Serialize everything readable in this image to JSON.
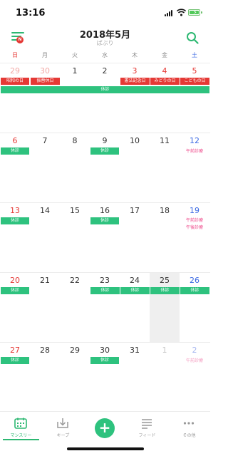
{
  "status": {
    "time": "13:16"
  },
  "header": {
    "title": "2018年5月",
    "subtitle": "ぱぶり",
    "menu_badge": "N"
  },
  "weekdays": [
    "日",
    "月",
    "火",
    "水",
    "木",
    "金",
    "土"
  ],
  "weeks": [
    {
      "days": [
        "29",
        "30",
        "1",
        "2",
        "3",
        "4",
        "5"
      ]
    },
    {
      "days": [
        "6",
        "7",
        "8",
        "9",
        "10",
        "11",
        "12"
      ]
    },
    {
      "days": [
        "13",
        "14",
        "15",
        "16",
        "17",
        "18",
        "19"
      ]
    },
    {
      "days": [
        "20",
        "21",
        "22",
        "23",
        "24",
        "25",
        "26"
      ]
    },
    {
      "days": [
        "27",
        "28",
        "29",
        "30",
        "31",
        "1",
        "2"
      ]
    }
  ],
  "holidays": {
    "showa": "昭和の日",
    "substitute": "振替休日",
    "constitution": "憲法記念日",
    "greenery": "みどりの日",
    "children": "こどもの日"
  },
  "events": {
    "rest": "休診",
    "morning_off": "午前診療",
    "afternoon_off": "午後診療"
  },
  "tabs": {
    "monthly": "マンスリー",
    "keep": "キープ",
    "add": "+",
    "feed": "フィード",
    "other": "その他"
  },
  "colors": {
    "accent": "#2db872",
    "holiday": "#e53935",
    "saturday": "#3d6be3",
    "note": "#ef4b8c"
  }
}
